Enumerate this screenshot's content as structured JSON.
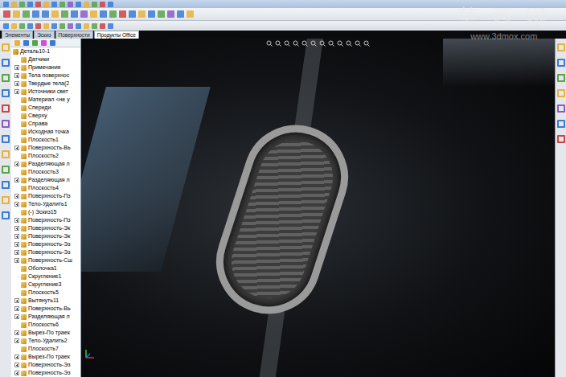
{
  "watermark": {
    "title": "莫 西 网",
    "url": "www.3dmox.com"
  },
  "tabs": [
    {
      "label": "Элементы",
      "selected": false
    },
    {
      "label": "Эскиз",
      "selected": false
    },
    {
      "label": "Поверхности",
      "selected": false
    },
    {
      "label": "Продукты Office",
      "selected": true
    }
  ],
  "tree": {
    "root": "Деталь10-1",
    "items": [
      {
        "label": "Датчики",
        "expandable": false
      },
      {
        "label": "Примечания",
        "expandable": true
      },
      {
        "label": "Тела поверхнос",
        "expandable": true
      },
      {
        "label": "Твердые тела(2",
        "expandable": true
      },
      {
        "label": "Источники свет",
        "expandable": true
      },
      {
        "label": "Материал <не у",
        "expandable": false
      },
      {
        "label": "Спереди",
        "expandable": false
      },
      {
        "label": "Сверху",
        "expandable": false
      },
      {
        "label": "Справа",
        "expandable": false
      },
      {
        "label": "Исходная точка",
        "expandable": false
      },
      {
        "label": "Плоскость1",
        "expandable": false
      },
      {
        "label": "Поверхность-Вь",
        "expandable": true
      },
      {
        "label": "Плоскость2",
        "expandable": false
      },
      {
        "label": "Разделяющая л",
        "expandable": true
      },
      {
        "label": "Плоскость3",
        "expandable": false
      },
      {
        "label": "Разделяющая л",
        "expandable": true
      },
      {
        "label": "Плоскость4",
        "expandable": false
      },
      {
        "label": "Поверхность-Пз",
        "expandable": true
      },
      {
        "label": "Тело-Удалить1",
        "expandable": true
      },
      {
        "label": "(-) Эскиз15",
        "expandable": false
      },
      {
        "label": "Поверхность-Пз",
        "expandable": true
      },
      {
        "label": "Поверхность-Эк",
        "expandable": true
      },
      {
        "label": "Поверхность-Эк",
        "expandable": true
      },
      {
        "label": "Поверхность-Эз",
        "expandable": true
      },
      {
        "label": "Поверхность-Эз",
        "expandable": true
      },
      {
        "label": "Поверхность-Сш",
        "expandable": true
      },
      {
        "label": "Оболочка1",
        "expandable": false
      },
      {
        "label": "Скругление1",
        "expandable": false
      },
      {
        "label": "Скругление3",
        "expandable": false
      },
      {
        "label": "Плоскость5",
        "expandable": false
      },
      {
        "label": "Вытянуть11",
        "expandable": true
      },
      {
        "label": "Поверхность-Вь",
        "expandable": true
      },
      {
        "label": "Разделяющая л",
        "expandable": true
      },
      {
        "label": "Плоскость6",
        "expandable": false
      },
      {
        "label": "Вырез-По траек",
        "expandable": true
      },
      {
        "label": "Тело-Удалить2",
        "expandable": true
      },
      {
        "label": "Плоскость7",
        "expandable": false
      },
      {
        "label": "Вырез-По траек",
        "expandable": true
      },
      {
        "label": "Поверхность-Эз",
        "expandable": true
      },
      {
        "label": "Поверхность-Эз",
        "expandable": true
      }
    ]
  }
}
